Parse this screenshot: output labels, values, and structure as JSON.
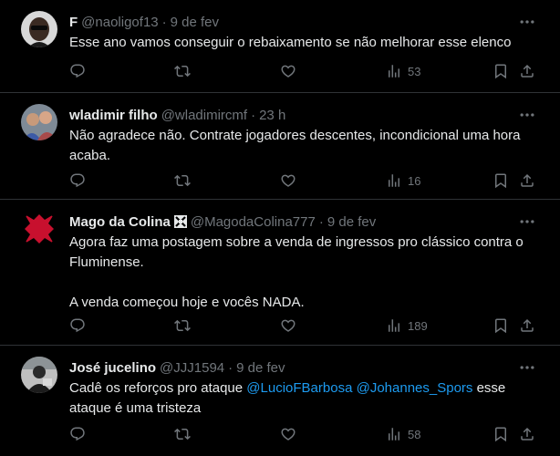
{
  "tweets": [
    {
      "name": "F",
      "handle": "@naoligof13",
      "separator": "·",
      "time": "9 de fev",
      "paragraphs": [
        "Esse ano vamos conseguir o rebaixamento se não melhorar esse elenco"
      ],
      "views": "53"
    },
    {
      "name": "wladimir filho",
      "handle": "@wladimircmf",
      "separator": "·",
      "time": "23 h",
      "paragraphs": [
        "Não agradece não. Contrate jogadores descentes, incondicional uma hora acaba."
      ],
      "views": "16"
    },
    {
      "name": "Mago da Colina",
      "handle": "@MagodaColina777",
      "separator": "·",
      "time": "9 de fev",
      "paragraphs": [
        "Agora faz uma postagem sobre a venda de ingressos pro clássico contra o Fluminense.",
        "A venda começou hoje e vocês NADA."
      ],
      "views": "189"
    },
    {
      "name": "José jucelino",
      "handle": "@JJJ1594",
      "separator": "·",
      "time": "9 de fev",
      "text_before": "Cadê os reforços pro ataque ",
      "mention1": "@LucioFBarbosa",
      "space": " ",
      "mention2": "@Johannes_Spors",
      "text_after": " esse ataque é uma tristeza",
      "views": "58"
    }
  ],
  "icons": {
    "more": "more-icon",
    "reply": "reply-icon",
    "retweet": "retweet-icon",
    "like": "like-icon",
    "views": "views-icon",
    "bookmark": "bookmark-icon",
    "share": "share-icon"
  },
  "colors": {
    "background": "#000000",
    "text": "#e7e9ea",
    "secondary": "#71767b",
    "link": "#1d9bf0",
    "divider": "#2f3336"
  }
}
